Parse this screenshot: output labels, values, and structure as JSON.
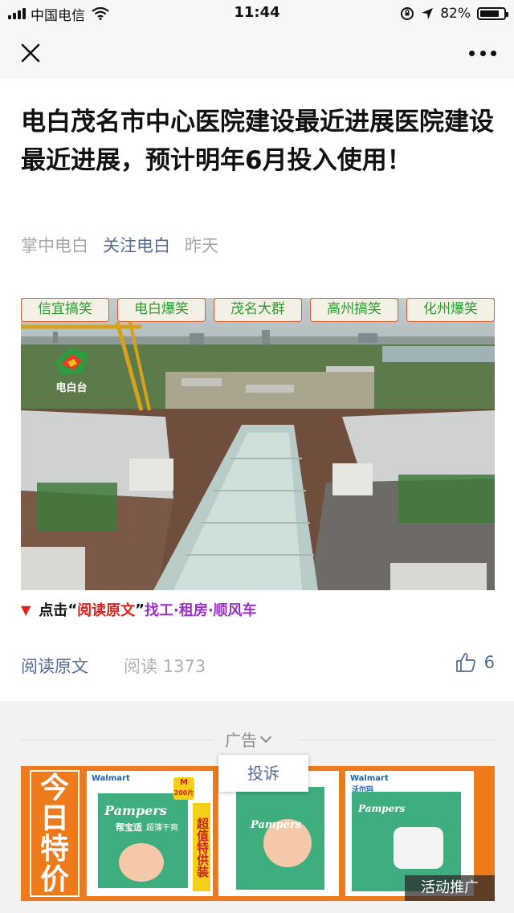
{
  "status_bar": {
    "carrier": "中国电信",
    "time": "11:44",
    "battery": "82%",
    "battery_level": 0.82
  },
  "nav": {
    "close_icon": "close-icon",
    "more_icon": "more-icon"
  },
  "article": {
    "title": "电白茂名市中心医院建设最近进展医院建设最近进展，预计明年6月投入使用！",
    "source": "掌中电白",
    "account": "关注电白",
    "date": "昨天",
    "tags": [
      "信宜搞笑",
      "电白爆笑",
      "茂名大群",
      "高州搞笑",
      "化州爆笑"
    ],
    "photo_logo": "电白台",
    "promo": {
      "prefix": "点击",
      "quote_open": "“",
      "link": "阅读原文",
      "quote_close": "”",
      "suffix": "找工·租房·顺风车"
    },
    "read_original": "阅读原文",
    "read_label": "阅读",
    "read_count": "1373",
    "like_count": "6"
  },
  "ad": {
    "label": "广告",
    "complain": "投诉",
    "banner_title": "今日特价",
    "brand_walmart": "Walmart",
    "brand_walmart_cn": "沃尔玛",
    "brand_pampers": "Pampers",
    "product_name": "帮宝适",
    "product_sub": "超薄干爽",
    "size_tag": "M",
    "count_tag": "200片",
    "deal_tag": "超值特供装",
    "badge": "活动推广",
    "colors": {
      "banner_bg": "#ee7a1b",
      "box_green": "#3fae7e"
    }
  },
  "colors": {
    "link_blue": "#576b95",
    "tag_green": "#2d9a35",
    "tag_border": "#e25b2a",
    "promo_red": "#e0201b",
    "promo_purple": "#9b2fcb"
  }
}
